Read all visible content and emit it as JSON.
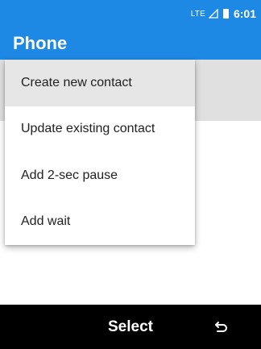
{
  "status_bar": {
    "network": "LTE",
    "time": "6:01",
    "icons": [
      "signal-icon",
      "battery-icon"
    ]
  },
  "app_bar": {
    "title": "Phone"
  },
  "menu": {
    "items": [
      {
        "label": "Create new contact",
        "selected": true
      },
      {
        "label": "Update existing contact",
        "selected": false
      },
      {
        "label": "Add 2-sec pause",
        "selected": false
      },
      {
        "label": "Add wait",
        "selected": false
      }
    ]
  },
  "softkeys": {
    "center": "Select",
    "right_icon": "back-icon"
  },
  "colors": {
    "primary": "#1e88e5",
    "selected_item": "#e6e6e6",
    "softkey_bar": "#000000"
  }
}
